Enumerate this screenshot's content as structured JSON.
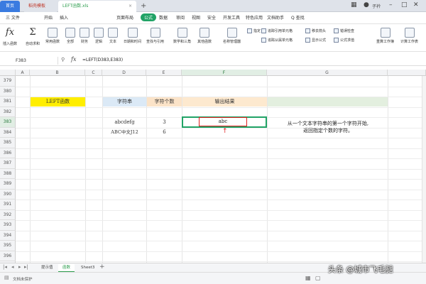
{
  "titlebar": {
    "home_tab": "首页",
    "file_tab": "稻壳模板",
    "active_tab": "LEFT函数.xls",
    "new_tab": "+",
    "user": "子衿"
  },
  "menus": [
    "三 文件",
    "开始",
    "插入",
    "页面布局",
    "公式",
    "数据",
    "审阅",
    "视图",
    "安全",
    "开发工具",
    "特色应用",
    "文档助手",
    "Q 查找"
  ],
  "active_menu": "公式",
  "ribbon": {
    "insert_function": "插入函数",
    "buttons": [
      "自动求和",
      "常用函数",
      "全部",
      "财务",
      "逻辑",
      "文本",
      "日期和时间",
      "查找与引用",
      "数学和三角",
      "其他函数",
      "名称管理器"
    ],
    "small_buttons": [
      "指定",
      "追踪引用单元格",
      "追踪从属单元格",
      "移去箭头",
      "显示公式",
      "错误检查",
      "公式求值"
    ],
    "right_buttons": [
      "重算工作簿",
      "计算工作表"
    ]
  },
  "formula_bar": {
    "name_box": "F383",
    "fx": "fx",
    "formula": "=LEFT(D383,E383)"
  },
  "columns": [
    "A",
    "B",
    "C",
    "D",
    "E",
    "F",
    "G"
  ],
  "selected_column": "F",
  "rows": [
    "379",
    "380",
    "381",
    "382",
    "383",
    "384",
    "385",
    "386",
    "387",
    "388",
    "389",
    "390",
    "391",
    "392",
    "393",
    "394",
    "395",
    "396",
    "397",
    "398"
  ],
  "selected_row": "383",
  "sheet": {
    "title_cell": "LEFT函数",
    "header_string": "字符串",
    "header_count": "字符个数",
    "header_result": "输出结果",
    "row1_string": "abcdefg",
    "row1_count": "3",
    "row1_result": "abc",
    "row2_string": "ABC中文J12",
    "row2_count": "6",
    "note_line1": "从一个文本字符串的第一个字符开始,",
    "note_line2": "返回指定个数的字符。"
  },
  "sheet_tabs": [
    "提示值",
    "函数",
    "Sheet3"
  ],
  "active_sheet": "函数",
  "status": {
    "left": "文档未保护"
  },
  "watermark": "头条 @城市飞毛腿",
  "colors": {
    "accent": "#21a366",
    "title_yellow": "#ffee00",
    "header_blue": "#dbe9f6",
    "header_orange": "#fbe3c8",
    "header_peach": "#fde9cf",
    "header_green": "#e3efdf",
    "selection_green": "#21a366",
    "highlight_red": "#e02020"
  }
}
